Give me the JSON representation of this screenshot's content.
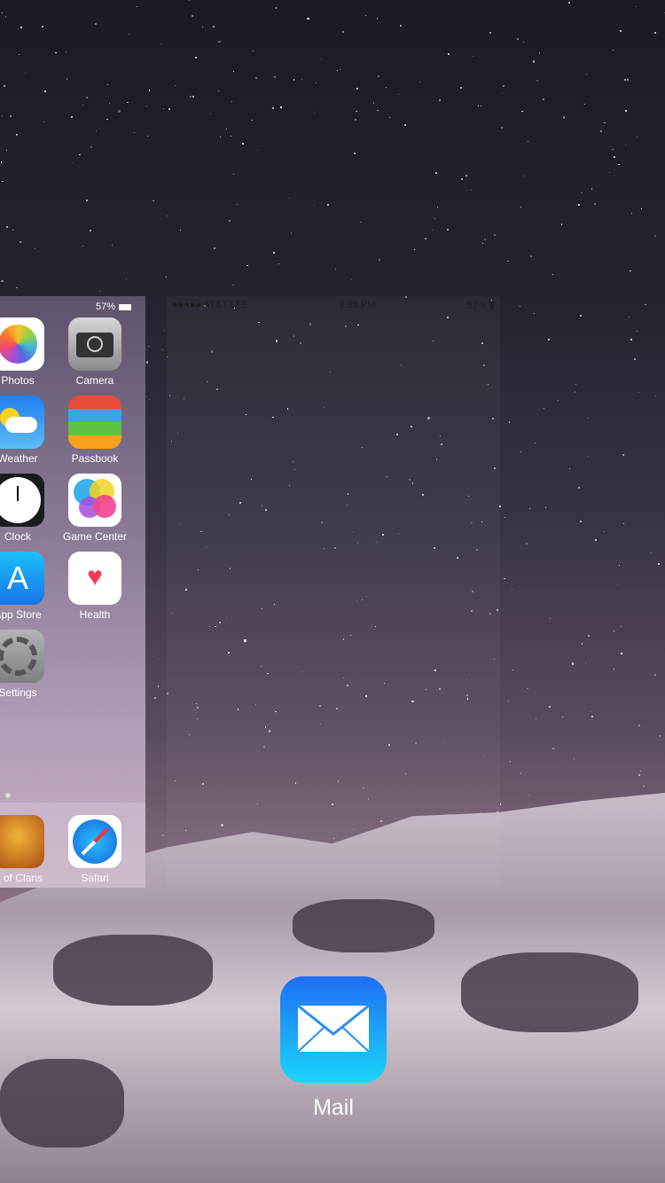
{
  "left_card": {
    "status": {
      "battery": "57%"
    },
    "apps": [
      {
        "label": "Photos",
        "icon": "photos-icon"
      },
      {
        "label": "Camera",
        "icon": "camera-icon"
      },
      {
        "label": "Weather",
        "icon": "weather-icon"
      },
      {
        "label": "Passbook",
        "icon": "passbook-icon"
      },
      {
        "label": "Clock",
        "icon": "clock-icon"
      },
      {
        "label": "Game Center",
        "icon": "game-center-icon"
      },
      {
        "label": "App Store",
        "icon": "app-store-icon"
      },
      {
        "label": "Health",
        "icon": "health-icon"
      },
      {
        "label": "Settings",
        "icon": "settings-icon"
      }
    ],
    "dock": [
      {
        "label": "Clash of Clans",
        "icon": "clash-of-clans-icon"
      },
      {
        "label": "Safari",
        "icon": "safari-icon"
      }
    ]
  },
  "mid_card": {
    "status": {
      "carrier": "●●●●● AT&T  LTE",
      "time": "7:28 PM",
      "battery": "57%"
    }
  },
  "switcher_app": {
    "label": "Mail",
    "icon": "mail-icon",
    "color": "#1e8cf4"
  }
}
